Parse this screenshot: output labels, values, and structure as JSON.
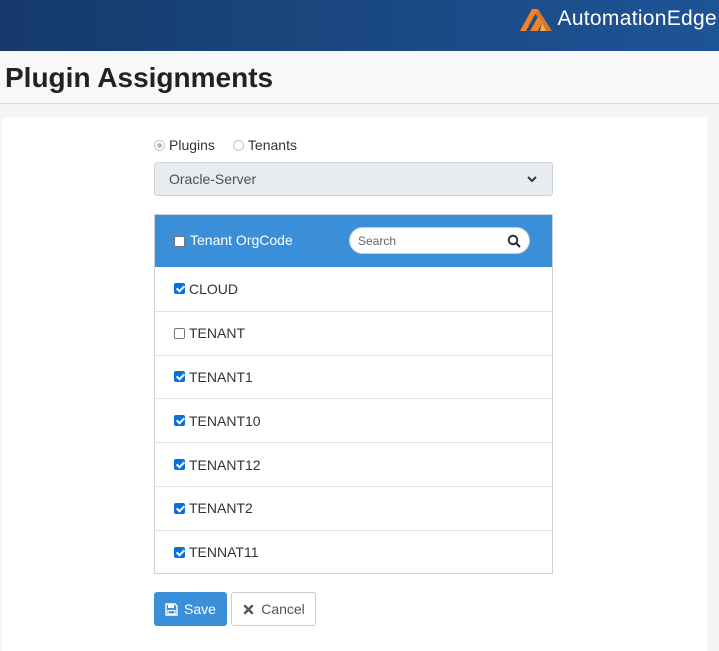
{
  "brand": {
    "name": "AutomationEdge"
  },
  "page": {
    "title": "Plugin Assignments"
  },
  "mode": {
    "options": [
      {
        "label": "Plugins",
        "checked": true
      },
      {
        "label": "Tenants",
        "checked": false
      }
    ]
  },
  "plugin_select": {
    "value": "Oracle-Server"
  },
  "table": {
    "header_label": "Tenant OrgCode",
    "header_checked": false,
    "search": {
      "placeholder": "Search",
      "value": ""
    },
    "rows": [
      {
        "label": "CLOUD",
        "checked": true
      },
      {
        "label": "TENANT",
        "checked": false
      },
      {
        "label": "TENANT1",
        "checked": true
      },
      {
        "label": "TENANT10",
        "checked": true
      },
      {
        "label": "TENANT12",
        "checked": true
      },
      {
        "label": "TENANT2",
        "checked": true
      },
      {
        "label": "TENNAT11",
        "checked": true
      }
    ]
  },
  "actions": {
    "save_label": "Save",
    "cancel_label": "Cancel"
  },
  "icons": {
    "save": "floppy-disk-icon",
    "cancel": "x-icon",
    "search": "magnifier-icon",
    "dropdown": "chevron-down-icon"
  },
  "colors": {
    "topbar": "#1b4a86",
    "accent": "#3b8fd9",
    "logo_orange": "#f58220"
  }
}
